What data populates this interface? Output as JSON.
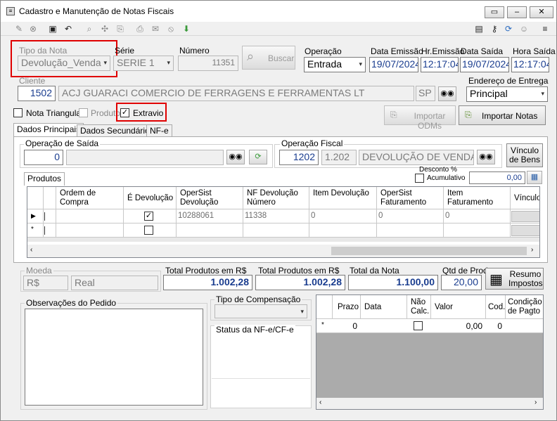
{
  "window": {
    "title": "Cadastro e Manutenção de Notas Fiscais"
  },
  "header": {
    "tipo_nota_label": "Tipo da Nota",
    "tipo_nota_value": "Devolução_Venda",
    "serie_label": "Série",
    "serie_value": "SERIE 1",
    "numero_label": "Número",
    "numero_value": "11351",
    "buscar_label": "Buscar",
    "operacao_label": "Operação",
    "operacao_value": "Entrada",
    "data_emissao_label": "Data Emissão",
    "data_emissao_value": "19/07/2024",
    "hr_emissao_label": "Hr.Emissão",
    "hr_emissao_value": "12:17:04",
    "data_saida_label": "Data Saída",
    "data_saida_value": "19/07/2024",
    "hora_saida_label": "Hora Saída",
    "hora_saida_value": "12:17:04",
    "cliente_label": "Cliente",
    "cliente_code": "1502",
    "cliente_name": "ACJ GUARACI COMERCIO DE FERRAGENS E FERRAMENTAS LT",
    "cliente_uf": "SP",
    "endereco_label": "Endereço de Entrega",
    "endereco_value": "Principal"
  },
  "options": {
    "nota_triangular": "Nota Triangular",
    "produtor": "Produtor",
    "extravio": "Extravio",
    "importar_odms": "Importar ODMs",
    "importar_notas": "Importar Notas"
  },
  "tabs": [
    "Dados Principais",
    "Dados Secundários",
    "NF-e"
  ],
  "principal": {
    "op_saida_label": "Operação de Saída",
    "op_saida_value": "0",
    "op_fiscal_label": "Operação Fiscal",
    "op_fiscal_code": "1202",
    "op_fiscal_cfop": "1.202",
    "op_fiscal_desc": "DEVOLUÇÃO DE VENDA",
    "vinculo_label": "Vínculo de Bens",
    "produtos_tab": "Produtos",
    "desconto_label": "Desconto %",
    "acumulativo_label": "Acumulativo",
    "desconto_value": "0,00"
  },
  "grid": {
    "columns": [
      "Ordem de Compra",
      "É Devolução",
      "OperSist Devolução",
      "NF Devolução Número",
      "Item Devolução",
      "OperSist Faturamento",
      "Item Faturamento",
      "Vínculo"
    ],
    "rows": [
      {
        "opersist_dev": "10288061",
        "nf_dev": "11338",
        "item_dev": "0",
        "opersist_fat": "0",
        "item_fat": "0"
      }
    ]
  },
  "totals": {
    "moeda_label": "Moeda",
    "moeda_code": "R$",
    "moeda_name": "Real",
    "total_prod_label1": "Total Produtos em R$",
    "total_prod_value1": "1.002,28",
    "total_prod_label2": "Total Produtos em R$",
    "total_prod_value2": "1.002,28",
    "total_nota_label": "Total da Nota",
    "total_nota_value": "1.100,00",
    "qtd_prod_label": "Qtd de Prod.",
    "qtd_prod_value": "20,00",
    "resumo_label": "Resumo Impostos"
  },
  "bottom": {
    "obs_label": "Observações do Pedido",
    "tipo_comp_label": "Tipo de Compensação",
    "status_label": "Status da NF-e/CF-e",
    "parcelas_cols": [
      "Prazo",
      "Data",
      "Não Calc.",
      "Valor",
      "Cod.",
      "Condição de Pagto"
    ],
    "parcela_prazo": "0",
    "parcela_valor": "0,00",
    "parcela_cod": "0"
  }
}
